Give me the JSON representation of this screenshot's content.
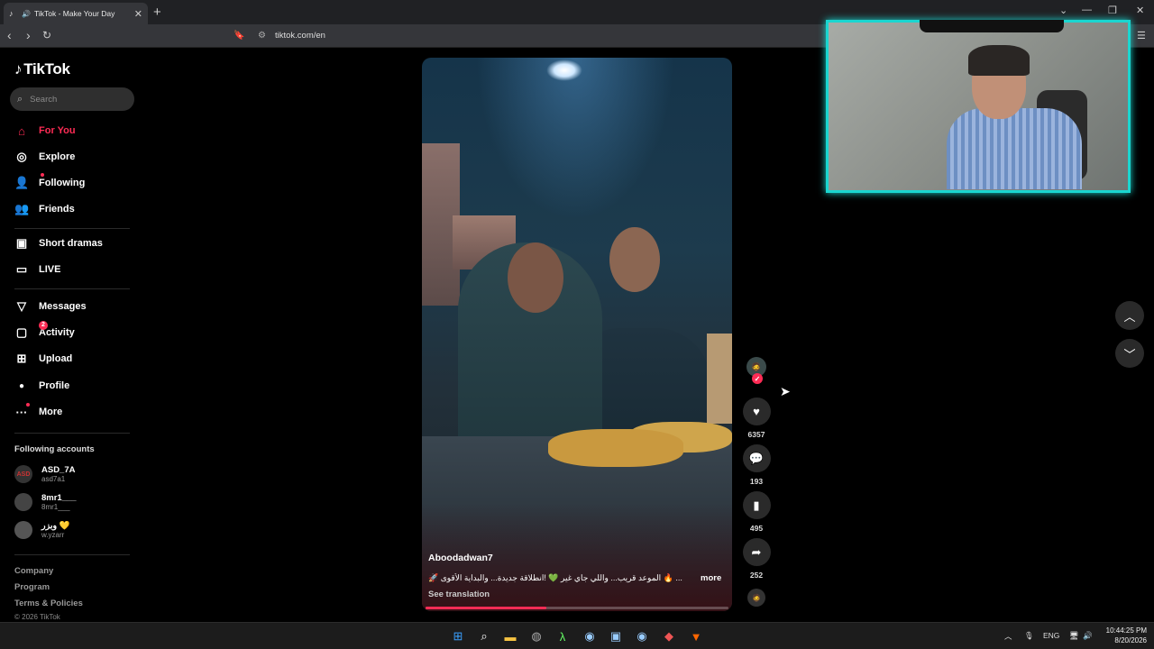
{
  "browser": {
    "tab_title": "TikTok - Make Your Day",
    "url": "tiktok.com/en"
  },
  "sidebar": {
    "logo": "TikTok",
    "search_placeholder": "Search",
    "nav": [
      {
        "label": "For You",
        "icon": "home-icon",
        "active": true
      },
      {
        "label": "Explore",
        "icon": "compass-icon"
      },
      {
        "label": "Following",
        "icon": "user-follow-icon"
      },
      {
        "label": "Friends",
        "icon": "friends-icon"
      },
      {
        "label": "Short dramas",
        "icon": "film-icon"
      },
      {
        "label": "LIVE",
        "icon": "tv-icon"
      },
      {
        "label": "Messages",
        "icon": "send-icon"
      },
      {
        "label": "Activity",
        "icon": "inbox-icon",
        "badge": "2"
      },
      {
        "label": "Upload",
        "icon": "plus-square-icon"
      },
      {
        "label": "Profile",
        "icon": "avatar-icon"
      },
      {
        "label": "More",
        "icon": "more-dots-icon"
      }
    ],
    "following_title": "Following accounts",
    "accounts": [
      {
        "name": "ASD_7A",
        "handle": "asd7a1",
        "avatar": "ASD"
      },
      {
        "name": "8mr1___",
        "handle": "8mr1___",
        "avatar": ""
      },
      {
        "name": "وبزر 💛",
        "handle": "w.yzarr",
        "avatar": ""
      }
    ],
    "footer": [
      "Company",
      "Program",
      "Terms & Policies"
    ],
    "copyright": "© 2026 TikTok"
  },
  "video": {
    "author": "Aboodadwan7",
    "caption": "🚀 الموعد قريب... واللي جاي غير 💚 !انطلاقة جديدة... والبداية الأقوى 🔥 ...",
    "more": "more",
    "translate": "See translation",
    "progress": 0.4
  },
  "actions": {
    "likes": "6357",
    "comments": "193",
    "saves": "495",
    "shares": "252"
  },
  "taskbar": {
    "lang": "ENG",
    "time": "10:44:25 PM",
    "date": "8/20/2026"
  },
  "colors": {
    "accent": "#fe2c55",
    "webcam_border": "#1ad6d0"
  }
}
